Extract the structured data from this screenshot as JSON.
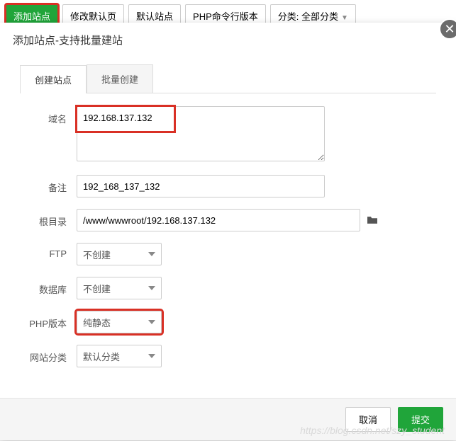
{
  "topbar": {
    "add_site": "添加站点",
    "edit_default": "修改默认页",
    "default_site": "默认站点",
    "php_cli": "PHP命令行版本",
    "category": "分类: 全部分类"
  },
  "modal": {
    "title": "添加站点-支持批量建站",
    "close_glyph": "✕",
    "tabs": {
      "create": "创建站点",
      "batch": "批量创建"
    },
    "form": {
      "domain": {
        "label": "域名",
        "value": "192.168.137.132"
      },
      "remark": {
        "label": "备注",
        "value": "192_168_137_132"
      },
      "root": {
        "label": "根目录",
        "value": "/www/wwwroot/192.168.137.132"
      },
      "ftp": {
        "label": "FTP",
        "value": "不创建"
      },
      "db": {
        "label": "数据库",
        "value": "不创建"
      },
      "php": {
        "label": "PHP版本",
        "value": "纯静态"
      },
      "cat": {
        "label": "网站分类",
        "value": "默认分类"
      }
    },
    "footer": {
      "cancel": "取消",
      "submit": "提交"
    }
  },
  "watermark": "https://blog.csdn.net/szy_student"
}
